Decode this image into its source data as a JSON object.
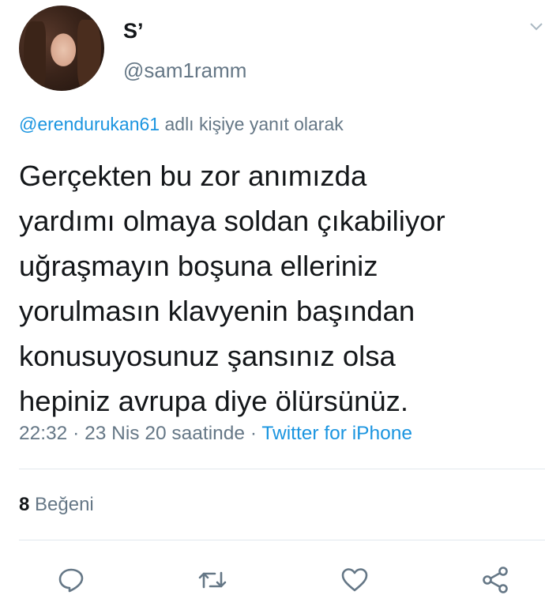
{
  "user": {
    "display_name": "S’",
    "handle": "@sam1ramm"
  },
  "reply": {
    "mention": "@erendurukan61",
    "suffix": " adlı kişiye yanıt olarak"
  },
  "tweet": {
    "text": "Gerçekten bu zor anımızda\nyardımı olmaya soldan çıkabiliyor\nuğraşmayın boşuna elleriniz\nyorulmasın klavyenin başından\nkonusuyosunuz şansınız olsa\nhepiniz avrupa diye ölürsünüz.",
    "time": "22:32",
    "date": "23 Nis 20 saatinde",
    "separator": " · ",
    "source": "Twitter for iPhone"
  },
  "stats": {
    "likes_count": "8",
    "likes_label": "Beğeni"
  },
  "actions": [
    "reply-icon",
    "retweet-icon",
    "like-icon",
    "share-icon"
  ],
  "colors": {
    "link": "#1b95e0",
    "secondary": "#657786",
    "text": "#14171a",
    "divider": "#e1e8ed"
  }
}
